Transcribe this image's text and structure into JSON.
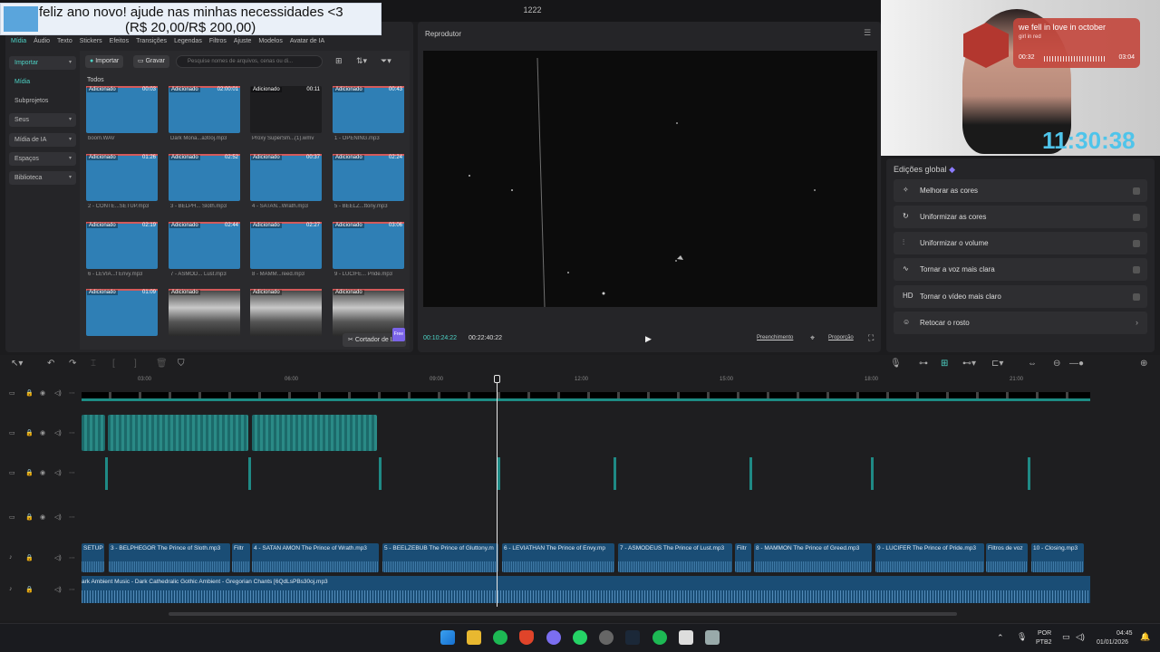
{
  "window": {
    "title": "1222"
  },
  "donation": {
    "line1": "feliz ano novo! ajude nas minhas necessidades <3",
    "line2": "(R$ 20,00/R$ 200,00)"
  },
  "menu_tabs": [
    "Mídia",
    "Áudio",
    "Texto",
    "Stickers",
    "Efeitos",
    "Transições",
    "Legendas",
    "Filtros",
    "Ajuste",
    "Modelos",
    "Avatar de IA"
  ],
  "side_categories": [
    "Importar",
    "Mídia",
    "Subprojetos",
    "Seus",
    "Mídia de IA",
    "Espaços",
    "Biblioteca"
  ],
  "media_toolbar": {
    "import": "Importar",
    "record": "Gravar",
    "search_placeholder": "Pesquise nomes de arquivos, cenas ou di..."
  },
  "section_label": "Todos",
  "tiles": [
    {
      "tag": "Adicionado",
      "dur": "00:03",
      "name": "boom.WAV",
      "kind": "audio"
    },
    {
      "tag": "Adicionado",
      "dur": "02:00:01",
      "name": "Dark Mona...a30oj.mp3",
      "kind": "audio"
    },
    {
      "tag": "Adicionado",
      "dur": "00:11",
      "name": "Proxy SuperSm...(1).wmv",
      "kind": "dark"
    },
    {
      "tag": "Adicionado",
      "dur": "00:43",
      "name": "1 - OPENING.mp3",
      "kind": "audio"
    },
    {
      "tag": "Adicionado",
      "dur": "01:26",
      "name": "2 - CONTE...SETUP.mp3",
      "kind": "audio"
    },
    {
      "tag": "Adicionado",
      "dur": "02:52",
      "name": "3 - BELPH... Sloth.mp3",
      "kind": "audio"
    },
    {
      "tag": "Adicionado",
      "dur": "00:37",
      "name": "4 - SATAN...Wrath.mp3",
      "kind": "audio"
    },
    {
      "tag": "Adicionado",
      "dur": "02:24",
      "name": "5 - BEELZ...ttony.mp3",
      "kind": "audio"
    },
    {
      "tag": "Adicionado",
      "dur": "02:19",
      "name": "6 - LEVIA...f Envy.mp3",
      "kind": "audio"
    },
    {
      "tag": "Adicionado",
      "dur": "02:44",
      "name": "7 - ASMOD... Lust.mp3",
      "kind": "audio"
    },
    {
      "tag": "Adicionado",
      "dur": "02:27",
      "name": "8 - MAMM...reed.mp3",
      "kind": "audio"
    },
    {
      "tag": "Adicionado",
      "dur": "03:06",
      "name": "9 - LUCIFE... Pride.mp3",
      "kind": "audio"
    },
    {
      "tag": "Adicionado",
      "dur": "01:09",
      "name": "",
      "kind": "audio"
    },
    {
      "tag": "Adicionado",
      "dur": "",
      "name": "",
      "kind": "photo"
    },
    {
      "tag": "Adicionado",
      "dur": "",
      "name": "",
      "kind": "photo"
    },
    {
      "tag": "Adicionado",
      "dur": "",
      "name": "",
      "kind": "photo"
    }
  ],
  "ai_cutter": {
    "label": "Cortador de IA",
    "badge": "Free"
  },
  "player": {
    "title": "Reprodutor",
    "current": "00:10:24:22",
    "total": "00:22:40:22",
    "fill": "Preenchimento",
    "ratio": "Proporção"
  },
  "overlay": {
    "song_title": "we fell in love in october",
    "artist": "girl in red",
    "cur": "00:32",
    "tot": "03:04",
    "clock": "11:30:38"
  },
  "global_edits": {
    "title": "Edições global",
    "items": [
      "Melhorar as cores",
      "Uniformizar as cores",
      "Uniformizar o volume",
      "Tornar a voz mais clara",
      "Tornar o vídeo mais claro",
      "Retocar o rosto"
    ]
  },
  "ruler": [
    "03:00",
    "06:00",
    "09:00",
    "12:00",
    "15:00",
    "18:00",
    "21:00"
  ],
  "audio_clips": [
    "SETUP",
    "3 - BELPHEGOR The Prince of Sloth.mp3",
    "Filtr",
    "4 - SATAN AMON The Prince of Wrath.mp3",
    "5 - BEELZEBUB The Prince of Gluttony.m",
    "6 - LEVIATHAN The Prince of Envy.mp",
    "7 - ASMODEUS The Prince of Lust.mp3",
    "Filtr",
    "8 - MAMMON The Prince of Greed.mp3",
    "9 - LUCIFER The Prince of Pride.mp3",
    "Filtros de voz",
    "10 - Closing.mp3"
  ],
  "bg_audio": "ark Ambient Music - Dark Cathedralic Gothic Ambient - Gregorian Chants [6QdLsPBs30oj.mp3",
  "tray": {
    "lang1": "POR",
    "lang2": "PTB2",
    "time": "04:45",
    "date": "01/01/2026"
  }
}
